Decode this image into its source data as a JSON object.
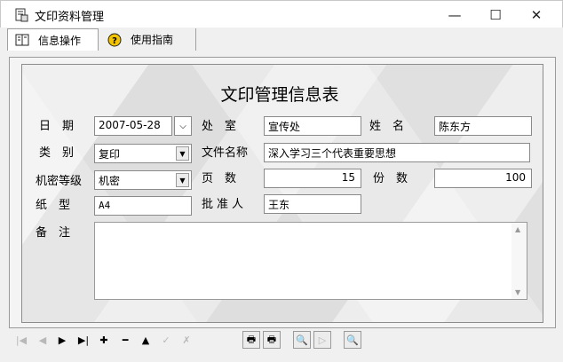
{
  "window": {
    "title": "文印资料管理",
    "controls": {
      "minimize": "—",
      "maximize": "☐",
      "close": "✕"
    }
  },
  "tabs": [
    {
      "label": "信息操作",
      "icon": "book-icon",
      "active": true
    },
    {
      "label": "使用指南",
      "icon": "help-icon",
      "active": false
    }
  ],
  "form": {
    "title": "文印管理信息表",
    "date": {
      "label": "日　期",
      "value": "2007-05-28"
    },
    "office": {
      "label": "处　室",
      "value": "宣传处"
    },
    "name": {
      "label": "姓　名",
      "value": "陈东方"
    },
    "category": {
      "label": "类　别",
      "value": "复印"
    },
    "file_name": {
      "label": "文件名称",
      "value": "深入学习三个代表重要思想"
    },
    "secrecy": {
      "label": "机密等级",
      "value": "机密"
    },
    "pages": {
      "label": "页　数",
      "value": "15"
    },
    "copies": {
      "label": "份　数",
      "value": "100"
    },
    "paper": {
      "label": "纸　型",
      "value": "A4"
    },
    "approver": {
      "label": "批准人",
      "value": "王东"
    },
    "notes": {
      "label": "备　注",
      "value": ""
    }
  },
  "toolbar": {
    "nav": [
      {
        "name": "first-record-icon",
        "glyph": "|◀",
        "enabled": false
      },
      {
        "name": "prior-record-icon",
        "glyph": "◀",
        "enabled": false
      },
      {
        "name": "next-record-icon",
        "glyph": "▶",
        "enabled": true
      },
      {
        "name": "last-record-icon",
        "glyph": "▶|",
        "enabled": true
      },
      {
        "name": "insert-record-icon",
        "glyph": "✚",
        "enabled": true
      },
      {
        "name": "delete-record-icon",
        "glyph": "━",
        "enabled": true
      },
      {
        "name": "edit-record-icon",
        "glyph": "▲",
        "enabled": true
      },
      {
        "name": "post-record-icon",
        "glyph": "✓",
        "enabled": false
      },
      {
        "name": "cancel-record-icon",
        "glyph": "✗",
        "enabled": false
      }
    ],
    "actions": [
      {
        "name": "print-icon",
        "glyph": "🖶"
      },
      {
        "name": "print-preview-icon",
        "glyph": "🖶"
      },
      {
        "name": "search-icon",
        "glyph": "🔍"
      },
      {
        "name": "play-icon",
        "glyph": "▷"
      },
      {
        "name": "zoom-icon",
        "glyph": "🔍"
      }
    ]
  }
}
